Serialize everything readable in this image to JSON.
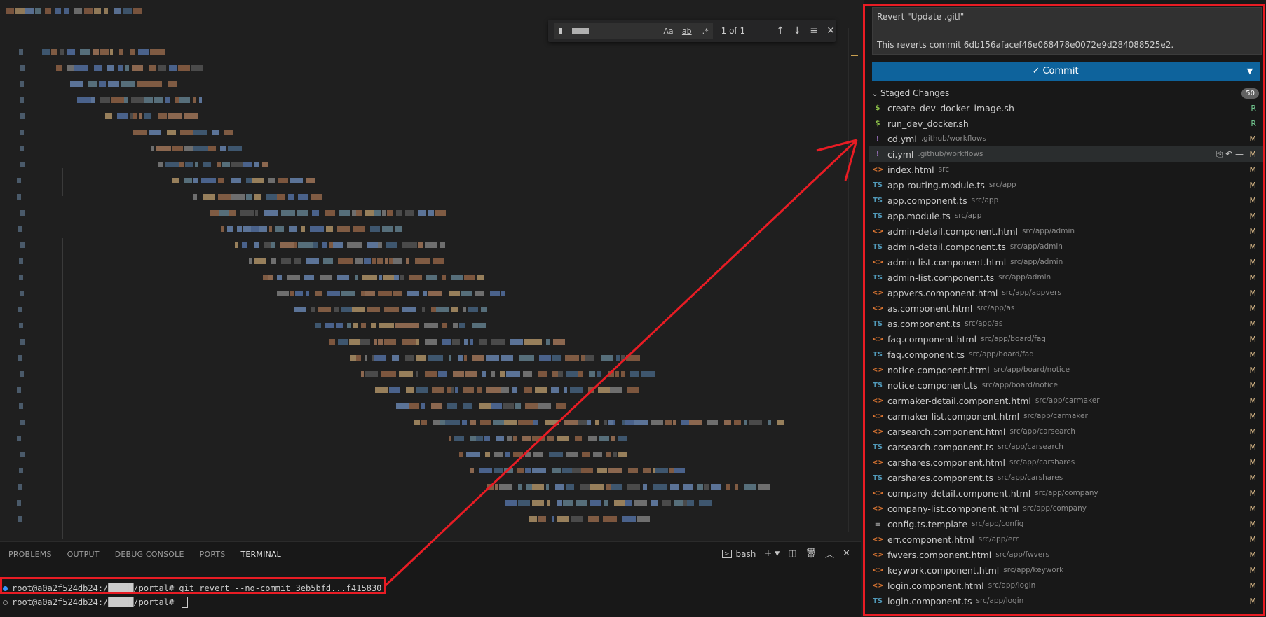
{
  "find": {
    "count": "1 of 1",
    "match_case": "Aa",
    "whole_word": "ab",
    "regex": ".*"
  },
  "panel": {
    "tabs": [
      {
        "label": "PROBLEMS"
      },
      {
        "label": "OUTPUT"
      },
      {
        "label": "DEBUG CONSOLE"
      },
      {
        "label": "PORTS"
      },
      {
        "label": "TERMINAL"
      }
    ],
    "shell_label": "bash",
    "terminal": {
      "line1": "root@a0a2f524db24:/█████/portal# git revert --no-commit 3eb5bfd...f415830",
      "line2": "root@a0a2f524db24:/█████/portal# "
    }
  },
  "scm": {
    "message_line1": "Revert \"Update .gitl\"",
    "message_line2": "This reverts commit 6db156afacef46e068478e0072e9d284088525e2.",
    "commit_label": "✓ Commit",
    "staged_label": "Staged Changes",
    "staged_count": "50",
    "files": [
      {
        "name": "create_dev_docker_image.sh",
        "path": "",
        "status": "R",
        "icon": "$"
      },
      {
        "name": "run_dev_docker.sh",
        "path": "",
        "status": "R",
        "icon": "$"
      },
      {
        "name": "cd.yml",
        "path": ".github/workflows",
        "status": "M",
        "icon": "!"
      },
      {
        "name": "ci.yml",
        "path": ".github/workflows",
        "status": "M",
        "icon": "!"
      },
      {
        "name": "index.html",
        "path": "src",
        "status": "M",
        "icon": "<>"
      },
      {
        "name": "app-routing.module.ts",
        "path": "src/app",
        "status": "M",
        "icon": "TS"
      },
      {
        "name": "app.component.ts",
        "path": "src/app",
        "status": "M",
        "icon": "TS"
      },
      {
        "name": "app.module.ts",
        "path": "src/app",
        "status": "M",
        "icon": "TS"
      },
      {
        "name": "admin-detail.component.html",
        "path": "src/app/admin",
        "status": "M",
        "icon": "<>"
      },
      {
        "name": "admin-detail.component.ts",
        "path": "src/app/admin",
        "status": "M",
        "icon": "TS"
      },
      {
        "name": "admin-list.component.html",
        "path": "src/app/admin",
        "status": "M",
        "icon": "<>"
      },
      {
        "name": "admin-list.component.ts",
        "path": "src/app/admin",
        "status": "M",
        "icon": "TS"
      },
      {
        "name": "appvers.component.html",
        "path": "src/app/appvers",
        "status": "M",
        "icon": "<>"
      },
      {
        "name": "as.component.html",
        "path": "src/app/as",
        "status": "M",
        "icon": "<>"
      },
      {
        "name": "as.component.ts",
        "path": "src/app/as",
        "status": "M",
        "icon": "TS"
      },
      {
        "name": "faq.component.html",
        "path": "src/app/board/faq",
        "status": "M",
        "icon": "<>"
      },
      {
        "name": "faq.component.ts",
        "path": "src/app/board/faq",
        "status": "M",
        "icon": "TS"
      },
      {
        "name": "notice.component.html",
        "path": "src/app/board/notice",
        "status": "M",
        "icon": "<>"
      },
      {
        "name": "notice.component.ts",
        "path": "src/app/board/notice",
        "status": "M",
        "icon": "TS"
      },
      {
        "name": "carmaker-detail.component.html",
        "path": "src/app/carmaker",
        "status": "M",
        "icon": "<>"
      },
      {
        "name": "carmaker-list.component.html",
        "path": "src/app/carmaker",
        "status": "M",
        "icon": "<>"
      },
      {
        "name": "carsearch.component.html",
        "path": "src/app/carsearch",
        "status": "M",
        "icon": "<>"
      },
      {
        "name": "carsearch.component.ts",
        "path": "src/app/carsearch",
        "status": "M",
        "icon": "TS"
      },
      {
        "name": "carshares.component.html",
        "path": "src/app/carshares",
        "status": "M",
        "icon": "<>"
      },
      {
        "name": "carshares.component.ts",
        "path": "src/app/carshares",
        "status": "M",
        "icon": "TS"
      },
      {
        "name": "company-detail.component.html",
        "path": "src/app/company",
        "status": "M",
        "icon": "<>"
      },
      {
        "name": "company-list.component.html",
        "path": "src/app/company",
        "status": "M",
        "icon": "<>"
      },
      {
        "name": "config.ts.template",
        "path": "src/app/config",
        "status": "M",
        "icon": "≡"
      },
      {
        "name": "err.component.html",
        "path": "src/app/err",
        "status": "M",
        "icon": "<>"
      },
      {
        "name": "fwvers.component.html",
        "path": "src/app/fwvers",
        "status": "M",
        "icon": "<>"
      },
      {
        "name": "keywork.component.html",
        "path": "src/app/keywork",
        "status": "M",
        "icon": "<>"
      },
      {
        "name": "login.component.html",
        "path": "src/app/login",
        "status": "M",
        "icon": "<>"
      },
      {
        "name": "login.component.ts",
        "path": "src/app/login",
        "status": "M",
        "icon": "TS"
      }
    ]
  },
  "colors": {
    "annotation_red": "#e81c24",
    "commit_blue": "#0e639c",
    "shell_ts": "#519aba",
    "html_orange": "#e37933",
    "shell_green": "#8dc149",
    "yaml_purple": "#a074c4"
  }
}
